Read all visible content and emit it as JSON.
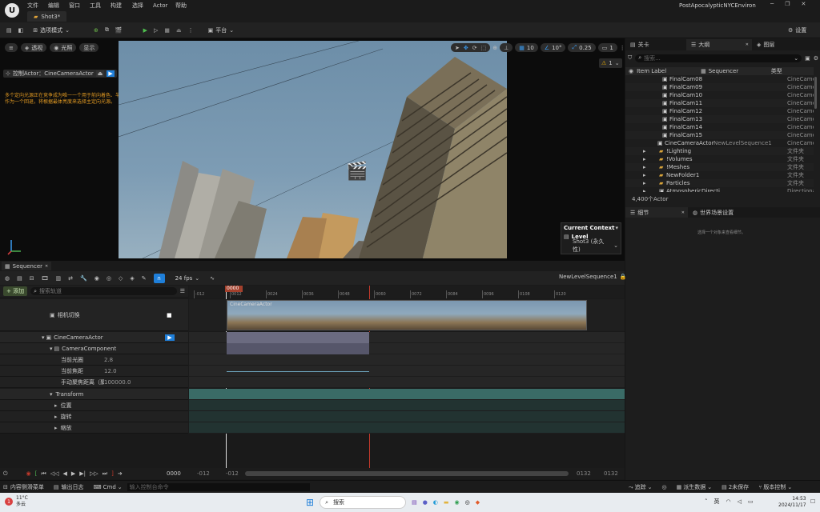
{
  "app": {
    "project": "PostApocalypticNYCEnviron",
    "tab": "Shot3*",
    "menu": [
      "文件",
      "编辑",
      "窗口",
      "工具",
      "构建",
      "选择",
      "Actor",
      "帮助"
    ]
  },
  "toolbar": {
    "mode": "选项模式",
    "platform": "平台",
    "settings": "设置"
  },
  "viewport": {
    "perspective": "透视",
    "lighting": "光照",
    "show": "显示",
    "pilot": "控制Actor：CineCameraActor",
    "warning_1": "多个定向光源正在竞争成为唯一一个用于前向着色、半透明、水或体积雾的光源。请调整他们的ForwardShadingPriority。",
    "warning_2": "作为一个回退，将根据最体亮度来选择主定向光源。",
    "grid": "10",
    "angle": "10°",
    "scale": "0.25",
    "cam_speed": "1",
    "warn_count": "1",
    "context_title": "Current Context",
    "context_level_label": "Level",
    "context_level": "Shot3 (永久性)"
  },
  "sequencer": {
    "tab": "Sequencer",
    "add": "+ 添加",
    "search_placeholder": "搜索轨道",
    "fps": "24 fps",
    "sequence_name": "NewLevelSequence1",
    "playhead": "0000",
    "ruler_ticks": [
      "-012",
      "0012",
      "0024",
      "0036",
      "0048",
      "0060",
      "0072",
      "0084",
      "0096",
      "0108",
      "0120"
    ],
    "clip_label": "CineCameraActor",
    "frame_start": "0000",
    "range_in_a": "-012",
    "range_in_b": "-012",
    "range_out_a": "0132",
    "range_out_b": "0132",
    "tracks": {
      "camera_cut": "相机切换",
      "actor": "CineCameraActor",
      "component": "CameraComponent",
      "aperture_label": "当前光圈",
      "aperture_value": "2.8",
      "focal_label": "当前焦距",
      "focal_value": "12.0",
      "focus_label": "手动聚焦距离（聚",
      "focus_value": "100000.0",
      "transform": "Transform",
      "location": "位置",
      "rotation": "旋转",
      "scale": "缩放"
    }
  },
  "outliner": {
    "tabs": [
      "关卡",
      "大纲",
      "图层"
    ],
    "search_placeholder": "搜索...",
    "col_label": "Item Label",
    "col_seq": "Sequencer",
    "col_type": "类型",
    "rows": [
      {
        "label": "FinalCam08",
        "seq": "",
        "type": "CineCame",
        "indent": 2
      },
      {
        "label": "FinalCam09",
        "seq": "",
        "type": "CineCame",
        "indent": 2
      },
      {
        "label": "FinalCam10",
        "seq": "",
        "type": "CineCame",
        "indent": 2
      },
      {
        "label": "FinalCam11",
        "seq": "",
        "type": "CineCame",
        "indent": 2
      },
      {
        "label": "FinalCam12",
        "seq": "",
        "type": "CineCame",
        "indent": 2
      },
      {
        "label": "FinalCam13",
        "seq": "",
        "type": "CineCame",
        "indent": 2
      },
      {
        "label": "FinalCam14",
        "seq": "",
        "type": "CineCame",
        "indent": 2
      },
      {
        "label": "FinalCam15",
        "seq": "",
        "type": "CineCame",
        "indent": 2
      },
      {
        "label": "CineCameraActor",
        "seq": "NewLevelSequence1",
        "type": "CineCame",
        "indent": 1
      },
      {
        "label": "!Lighting",
        "seq": "",
        "type": "文件夹",
        "indent": 0
      },
      {
        "label": "!Volumes",
        "seq": "",
        "type": "文件夹",
        "indent": 0
      },
      {
        "label": "!Meshes",
        "seq": "",
        "type": "文件夹",
        "indent": 0
      },
      {
        "label": "NewFolder1",
        "seq": "",
        "type": "文件夹",
        "indent": 0
      },
      {
        "label": "Particles",
        "seq": "",
        "type": "文件夹",
        "indent": 0
      },
      {
        "label": "AtmosphericDirecti",
        "seq": "",
        "type": "Directiona",
        "indent": 0
      }
    ],
    "count": "4,400个Actor"
  },
  "details": {
    "tabs": [
      "细节",
      "世界场景设置"
    ],
    "empty": "选择一个对象来查看细节。"
  },
  "statusbar": {
    "content_drawer": "内容侧滑菜单",
    "output_log": "输出日志",
    "cmd": "Cmd",
    "cmd_placeholder": "输入控制台命令",
    "trace": "追踪",
    "derived": "派生数据",
    "unsaved": "2未保存",
    "source_control": "版本控制"
  },
  "taskbar": {
    "weather_temp": "11°C",
    "weather_desc": "多云",
    "search": "搜索",
    "lang": "英",
    "time": "14:53",
    "date": "2024/11/17"
  },
  "colors": {
    "accent": "#1f7fd9",
    "timeline_clip": "#6b6b80",
    "transform_track": "#3a6b66",
    "playhead": "#c0392b"
  }
}
